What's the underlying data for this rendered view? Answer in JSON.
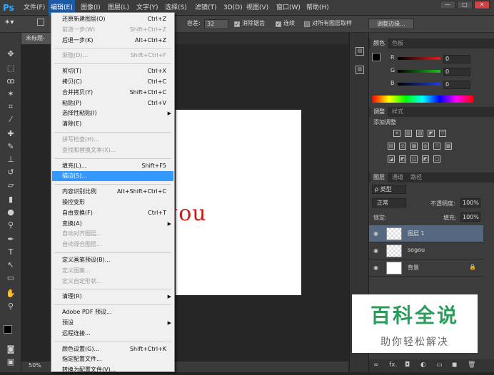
{
  "app": {
    "logo": "Ps"
  },
  "menubar": {
    "items": [
      "文件(F)",
      "编辑(E)",
      "图像(I)",
      "图层(L)",
      "文字(Y)",
      "选择(S)",
      "滤镜(T)",
      "3D(D)",
      "视图(V)",
      "窗口(W)",
      "帮助(H)"
    ],
    "active": "编辑(E)",
    "window_controls": [
      "—",
      "□",
      "✕"
    ]
  },
  "optionsbar": {
    "tolerance_label": "容差:",
    "tolerance_value": "32",
    "antialias_label": "消除锯齿",
    "contiguous_label": "连续",
    "sample_all_label": "对所有图层取样",
    "refine_edge_label": "调整边缘..."
  },
  "document": {
    "tab_title": "未标题-",
    "canvas_text": "gou",
    "canvas_text_color": "#cc1b1b",
    "zoom": "50%"
  },
  "edit_menu": {
    "items": [
      {
        "label": "还原新建图层(O)",
        "shortcut": "Ctrl+Z",
        "disabled": false
      },
      {
        "label": "前进一步(W)",
        "shortcut": "Shift+Ctrl+Z",
        "disabled": true
      },
      {
        "label": "后退一步(K)",
        "shortcut": "Alt+Ctrl+Z",
        "disabled": false
      },
      {
        "sep": true
      },
      {
        "label": "渐隐(D)...",
        "shortcut": "Shift+Ctrl+F",
        "disabled": true
      },
      {
        "sep": true
      },
      {
        "label": "剪切(T)",
        "shortcut": "Ctrl+X",
        "disabled": false
      },
      {
        "label": "拷贝(C)",
        "shortcut": "Ctrl+C",
        "disabled": false
      },
      {
        "label": "合并拷贝(Y)",
        "shortcut": "Shift+Ctrl+C",
        "disabled": false
      },
      {
        "label": "粘贴(P)",
        "shortcut": "Ctrl+V",
        "disabled": false
      },
      {
        "label": "选择性粘贴(I)",
        "shortcut": "",
        "submenu": true,
        "disabled": false
      },
      {
        "label": "清除(E)",
        "shortcut": "",
        "disabled": false
      },
      {
        "sep": true
      },
      {
        "label": "拼写检查(H)...",
        "shortcut": "",
        "disabled": true
      },
      {
        "label": "查找和替换文本(X)...",
        "shortcut": "",
        "disabled": true
      },
      {
        "sep": true
      },
      {
        "label": "填充(L)...",
        "shortcut": "Shift+F5",
        "disabled": false
      },
      {
        "label": "描边(S)...",
        "shortcut": "",
        "disabled": false,
        "highlighted": true
      },
      {
        "sep": true
      },
      {
        "label": "内容识别比例",
        "shortcut": "Alt+Shift+Ctrl+C",
        "disabled": false
      },
      {
        "label": "操控变形",
        "shortcut": "",
        "disabled": false
      },
      {
        "label": "自由变换(F)",
        "shortcut": "Ctrl+T",
        "disabled": false
      },
      {
        "label": "变换(A)",
        "shortcut": "",
        "submenu": true,
        "disabled": false
      },
      {
        "label": "自动对齐图层...",
        "shortcut": "",
        "disabled": true
      },
      {
        "label": "自动混合图层...",
        "shortcut": "",
        "disabled": true
      },
      {
        "sep": true
      },
      {
        "label": "定义画笔预设(B)...",
        "shortcut": "",
        "disabled": false
      },
      {
        "label": "定义图案...",
        "shortcut": "",
        "disabled": true
      },
      {
        "label": "定义自定形状...",
        "shortcut": "",
        "disabled": true
      },
      {
        "sep": true
      },
      {
        "label": "清理(R)",
        "shortcut": "",
        "submenu": true,
        "disabled": false
      },
      {
        "sep": true
      },
      {
        "label": "Adobe PDF 预设...",
        "shortcut": "",
        "disabled": false
      },
      {
        "label": "预设",
        "shortcut": "",
        "submenu": true,
        "disabled": false
      },
      {
        "label": "远程连接...",
        "shortcut": "",
        "disabled": false
      },
      {
        "sep": true
      },
      {
        "label": "颜色设置(G)...",
        "shortcut": "Shift+Ctrl+K",
        "disabled": false
      },
      {
        "label": "指定配置文件...",
        "shortcut": "",
        "disabled": false
      },
      {
        "label": "转换为配置文件(V)...",
        "shortcut": "",
        "disabled": false
      }
    ]
  },
  "color_panel": {
    "tabs": [
      "颜色",
      "色板"
    ],
    "channels": [
      {
        "name": "R",
        "value": "0",
        "color": "#e02020"
      },
      {
        "name": "G",
        "value": "0",
        "color": "#20c020"
      },
      {
        "name": "B",
        "value": "0",
        "color": "#2040e0"
      }
    ]
  },
  "adjust_panel": {
    "tabs": [
      "调整",
      "样式"
    ],
    "title": "添加调整",
    "row1": [
      "☀",
      "▥",
      "▨",
      "◩",
      "▽"
    ],
    "row2": [
      "▤",
      "⚖",
      "▦",
      "◍",
      "♲",
      "▦"
    ],
    "row3": [
      "◪",
      "◩",
      "◫",
      "◩",
      "▢"
    ]
  },
  "layers_panel": {
    "tabs": [
      "图层",
      "通道",
      "路径"
    ],
    "filter_label": "ρ 类型",
    "blend_mode": "正常",
    "opacity_label": "不透明度:",
    "opacity_value": "100%",
    "lock_label": "锁定:",
    "fill_label": "填充:",
    "fill_value": "100%",
    "layers": [
      {
        "name": "图层 1",
        "selected": true,
        "thumb": "transparent"
      },
      {
        "name": "sogou",
        "selected": false,
        "thumb": "transparent"
      },
      {
        "name": "背景",
        "selected": false,
        "thumb": "white",
        "locked": true
      }
    ],
    "footer_icons": [
      "∞",
      "fx.",
      "◘",
      "◐",
      "▭",
      "◼",
      "🗑"
    ]
  },
  "watermark": {
    "line1": "百科全说",
    "line2": "助你轻松解决",
    "color": "#2a9d5c"
  }
}
